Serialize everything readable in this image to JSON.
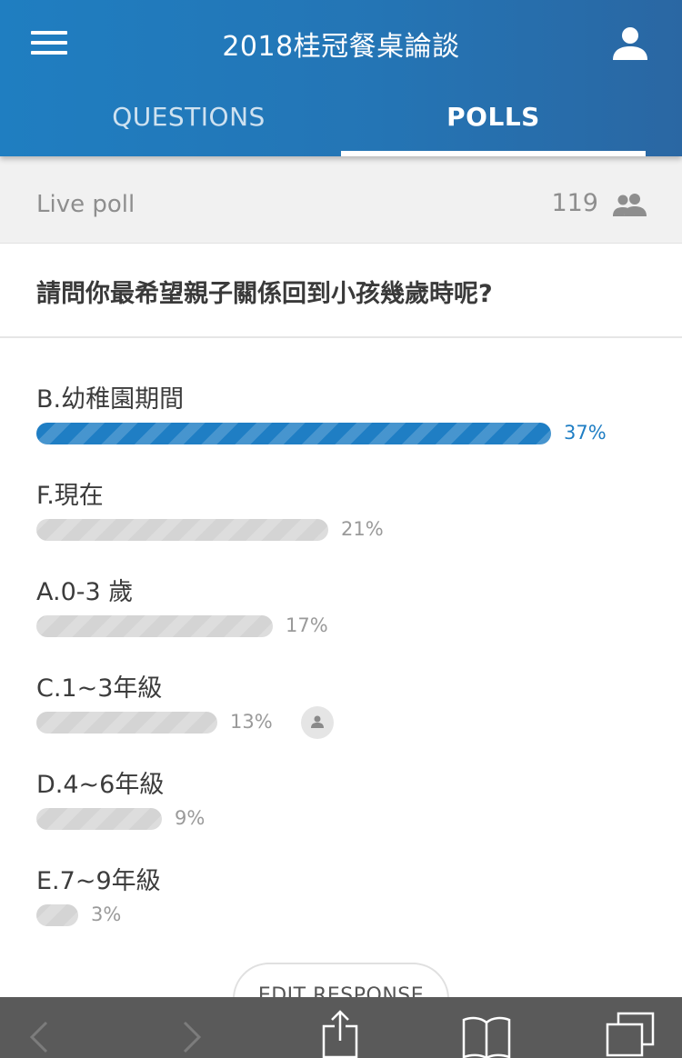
{
  "app": {
    "title": "2018桂冠餐桌論談",
    "tabs": [
      {
        "label": "QUESTIONS",
        "active": false
      },
      {
        "label": "POLLS",
        "active": true
      }
    ],
    "accent_color": "#1f7ec4"
  },
  "poll": {
    "status_label": "Live poll",
    "participants": "119",
    "question": "請問你最希望親子關係回到小孩幾歲時呢?",
    "options": [
      {
        "label": "B.幼稚園期間",
        "percent": 37,
        "percent_label": "37%",
        "leading": true
      },
      {
        "label": "F.現在",
        "percent": 21,
        "percent_label": "21%",
        "leading": false
      },
      {
        "label": "A.0-3 歲",
        "percent": 17,
        "percent_label": "17%",
        "leading": false
      },
      {
        "label": "C.1~3年級",
        "percent": 13,
        "percent_label": "13%",
        "leading": false,
        "my_vote": true
      },
      {
        "label": "D.4~6年級",
        "percent": 9,
        "percent_label": "9%",
        "leading": false
      },
      {
        "label": "E.7~9年級",
        "percent": 3,
        "percent_label": "3%",
        "leading": false
      }
    ],
    "edit_button_label": "EDIT RESPONSE"
  },
  "icons": {
    "menu": "menu-icon",
    "user": "user-icon",
    "participants": "people-icon",
    "voted": "person-icon",
    "browser": [
      "back-icon",
      "forward-icon",
      "share-icon",
      "bookmarks-icon",
      "tabs-icon"
    ]
  }
}
